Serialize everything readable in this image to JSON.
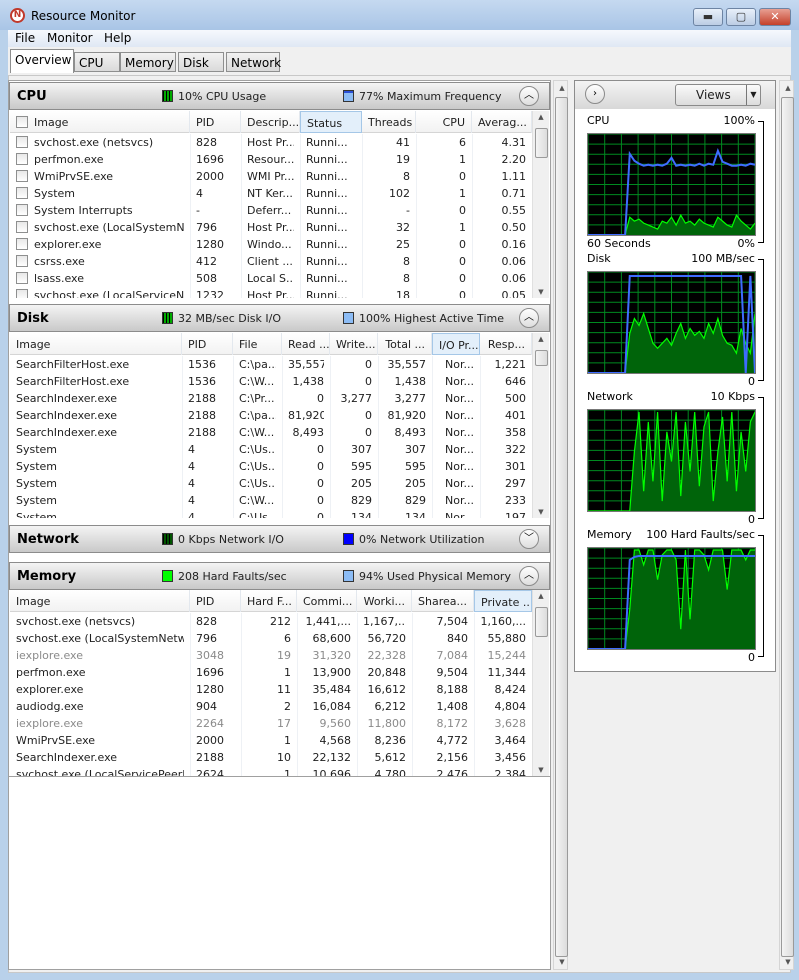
{
  "window": {
    "title": "Resource Monitor",
    "minimize": "▬",
    "maximize": "▢",
    "close": "✕"
  },
  "menu": [
    "File",
    "Monitor",
    "Help"
  ],
  "tabs": [
    "Overview",
    "CPU",
    "Memory",
    "Disk",
    "Network"
  ],
  "colors": {
    "green": "#00ff00",
    "blue": "#3e6cff",
    "darkgreen": "#00640a",
    "grid": "#008a20"
  },
  "cpu": {
    "title": "CPU",
    "stat1": "10% CPU Usage",
    "stat2": "77% Maximum Frequency",
    "columns": [
      "Image",
      "PID",
      "Descrip...",
      "Status",
      "Threads",
      "CPU",
      "Averag..."
    ],
    "rows": [
      [
        "svchost.exe (netsvcs)",
        "828",
        "Host Pr...",
        "Runni...",
        "41",
        "6",
        "4.31"
      ],
      [
        "perfmon.exe",
        "1696",
        "Resour...",
        "Runni...",
        "19",
        "1",
        "2.20"
      ],
      [
        "WmiPrvSE.exe",
        "2000",
        "WMI Pr...",
        "Runni...",
        "8",
        "0",
        "1.11"
      ],
      [
        "System",
        "4",
        "NT Ker...",
        "Runni...",
        "102",
        "1",
        "0.71"
      ],
      [
        "System Interrupts",
        "-",
        "Deferr...",
        "Runni...",
        "-",
        "0",
        "0.55"
      ],
      [
        "svchost.exe (LocalSystemNet...",
        "796",
        "Host Pr...",
        "Runni...",
        "32",
        "1",
        "0.50"
      ],
      [
        "explorer.exe",
        "1280",
        "Windo...",
        "Runni...",
        "25",
        "0",
        "0.16"
      ],
      [
        "csrss.exe",
        "412",
        "Client ...",
        "Runni...",
        "8",
        "0",
        "0.06"
      ],
      [
        "lsass.exe",
        "508",
        "Local S...",
        "Runni...",
        "8",
        "0",
        "0.06"
      ],
      [
        "svchost.exe (LocalServiceNo...",
        "1232",
        "Host Pr...",
        "Runni...",
        "18",
        "0",
        "0.05"
      ]
    ]
  },
  "disk": {
    "title": "Disk",
    "stat1": "32 MB/sec Disk I/O",
    "stat2": "100% Highest Active Time",
    "columns": [
      "Image",
      "PID",
      "File",
      "Read ...",
      "Write...",
      "Total ...",
      "I/O Pr...",
      "Resp..."
    ],
    "rows": [
      [
        "SearchFilterHost.exe",
        "1536",
        "C:\\pa...",
        "35,557",
        "0",
        "35,557",
        "Nor...",
        "1,221"
      ],
      [
        "SearchFilterHost.exe",
        "1536",
        "C:\\W...",
        "1,438",
        "0",
        "1,438",
        "Nor...",
        "646"
      ],
      [
        "SearchIndexer.exe",
        "2188",
        "C:\\Pr...",
        "0",
        "3,277",
        "3,277",
        "Nor...",
        "500"
      ],
      [
        "SearchIndexer.exe",
        "2188",
        "C:\\pa...",
        "81,920",
        "0",
        "81,920",
        "Nor...",
        "401"
      ],
      [
        "SearchIndexer.exe",
        "2188",
        "C:\\W...",
        "8,493",
        "0",
        "8,493",
        "Nor...",
        "358"
      ],
      [
        "System",
        "4",
        "C:\\Us...",
        "0",
        "307",
        "307",
        "Nor...",
        "322"
      ],
      [
        "System",
        "4",
        "C:\\Us...",
        "0",
        "595",
        "595",
        "Nor...",
        "301"
      ],
      [
        "System",
        "4",
        "C:\\Us...",
        "0",
        "205",
        "205",
        "Nor...",
        "297"
      ],
      [
        "System",
        "4",
        "C:\\W...",
        "0",
        "829",
        "829",
        "Nor...",
        "233"
      ],
      [
        "System",
        "4",
        "C:\\Us...",
        "0",
        "134",
        "134",
        "Nor...",
        "197"
      ]
    ]
  },
  "network": {
    "title": "Network",
    "stat1": "0 Kbps Network I/O",
    "stat2": "0% Network Utilization"
  },
  "memory": {
    "title": "Memory",
    "stat1": "208 Hard Faults/sec",
    "stat2": "94% Used Physical Memory",
    "columns": [
      "Image",
      "PID",
      "Hard F...",
      "Commi...",
      "Worki...",
      "Sharea...",
      "Private ..."
    ],
    "rows": [
      [
        "svchost.exe (netsvcs)",
        "828",
        "212",
        "1,441,...",
        "1,167,...",
        "7,504",
        "1,160,..."
      ],
      [
        "svchost.exe (LocalSystemNetwo...",
        "796",
        "6",
        "68,600",
        "56,720",
        "840",
        "55,880"
      ],
      [
        "iexplore.exe",
        "3048",
        "19",
        "31,320",
        "22,328",
        "7,084",
        "15,244"
      ],
      [
        "perfmon.exe",
        "1696",
        "1",
        "13,900",
        "20,848",
        "9,504",
        "11,344"
      ],
      [
        "explorer.exe",
        "1280",
        "11",
        "35,484",
        "16,612",
        "8,188",
        "8,424"
      ],
      [
        "audiodg.exe",
        "904",
        "2",
        "16,084",
        "6,212",
        "1,408",
        "4,804"
      ],
      [
        "iexplore.exe",
        "2264",
        "17",
        "9,560",
        "11,800",
        "8,172",
        "3,628"
      ],
      [
        "WmiPrvSE.exe",
        "2000",
        "1",
        "4,568",
        "8,236",
        "4,772",
        "3,464"
      ],
      [
        "SearchIndexer.exe",
        "2188",
        "10",
        "22,132",
        "5,612",
        "2,156",
        "3,456"
      ],
      [
        "svchost.exe (LocalServicePeerNet)",
        "2624",
        "1",
        "10,696",
        "4,780",
        "2,476",
        "2,384"
      ]
    ],
    "dimmed_rows": [
      2,
      6
    ]
  },
  "right": {
    "views": "Views",
    "graphs": [
      {
        "name": "CPU",
        "max": "100%",
        "left_bottom": "60 Seconds",
        "min": "0%",
        "green": [
          0,
          0,
          0,
          0,
          0,
          0,
          0,
          0,
          0,
          18,
          14,
          16,
          12,
          10,
          8,
          6,
          14,
          12,
          18,
          10,
          20,
          12,
          14,
          10,
          16,
          12,
          10,
          8,
          18,
          14,
          10,
          8,
          20,
          14,
          10,
          6,
          12
        ],
        "blue": [
          0,
          0,
          0,
          0,
          0,
          0,
          0,
          0,
          0,
          82,
          75,
          72,
          70,
          71,
          70,
          71,
          70,
          72,
          78,
          70,
          71,
          70,
          71,
          70,
          72,
          70,
          72,
          71,
          85,
          74,
          72,
          70,
          70,
          71,
          70,
          72,
          71
        ]
      },
      {
        "name": "Disk",
        "max": "100 MB/sec",
        "min": "0",
        "green": [
          0,
          0,
          0,
          0,
          0,
          0,
          0,
          0,
          0,
          40,
          55,
          48,
          60,
          45,
          30,
          25,
          30,
          35,
          28,
          40,
          50,
          35,
          45,
          38,
          42,
          35,
          50,
          40,
          55,
          38,
          30,
          28,
          20,
          45,
          30,
          20,
          60
        ],
        "blue": [
          0,
          0,
          0,
          0,
          0,
          0,
          0,
          0,
          0,
          98,
          98,
          98,
          98,
          98,
          98,
          98,
          98,
          98,
          98,
          98,
          98,
          98,
          98,
          98,
          98,
          98,
          98,
          98,
          98,
          98,
          98,
          98,
          98,
          98,
          0,
          98,
          0
        ]
      },
      {
        "name": "Network",
        "max": "10 Kbps",
        "min": "0",
        "green": [
          0,
          0,
          0,
          0,
          0,
          0,
          0,
          0,
          0,
          0,
          60,
          100,
          20,
          90,
          30,
          100,
          10,
          80,
          50,
          100,
          15,
          90,
          40,
          100,
          25,
          85,
          100,
          10,
          60,
          95,
          30,
          100,
          20,
          80,
          40,
          90,
          100
        ],
        "blue": []
      },
      {
        "name": "Memory",
        "max": "100 Hard Faults/sec",
        "min": "0",
        "green": [
          0,
          0,
          0,
          0,
          0,
          0,
          0,
          0,
          0,
          40,
          100,
          100,
          85,
          100,
          100,
          70,
          95,
          100,
          100,
          90,
          20,
          100,
          30,
          100,
          100,
          95,
          80,
          100,
          100,
          100,
          60,
          100,
          100,
          100,
          90,
          100,
          100
        ],
        "blue": [
          0,
          0,
          0,
          0,
          0,
          0,
          0,
          0,
          0,
          90,
          93,
          94,
          94,
          94,
          94,
          94,
          94,
          94,
          94,
          94,
          94,
          94,
          94,
          94,
          94,
          94,
          94,
          94,
          94,
          94,
          94,
          94,
          94,
          94,
          94,
          94,
          94
        ]
      }
    ]
  }
}
